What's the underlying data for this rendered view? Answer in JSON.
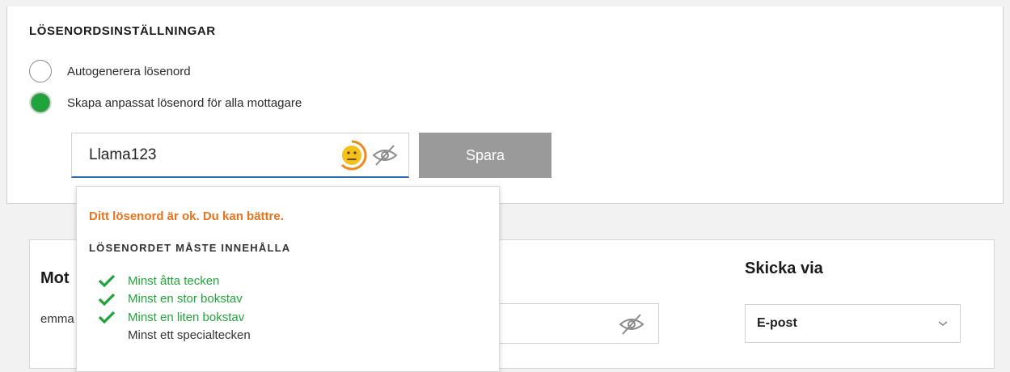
{
  "password_settings": {
    "title": "LÖSENORDSINSTÄLLNINGAR",
    "options": [
      {
        "label": "Autogenerera lösenord",
        "selected": false
      },
      {
        "label": "Skapa anpassat lösenord för alla mottagare",
        "selected": true
      }
    ],
    "password_value": "Llama123",
    "strength_icon": "neutral-face-icon",
    "visibility_icon": "eye-slash-icon",
    "save_label": "Spara",
    "colors": {
      "radio_selected": "#1fa43a",
      "strength_ring": "#f0891c",
      "strength_face": "#f3c01c",
      "save_button_bg": "#9a9a9a"
    }
  },
  "strength_popup": {
    "status": "Ditt lösenord är ok. Du kan bättre.",
    "subtitle": "LÖSENORDET MÅSTE INNEHÅLLA",
    "requirements": [
      {
        "label": "Minst åtta tecken",
        "met": true
      },
      {
        "label": "Minst en stor bokstav",
        "met": true
      },
      {
        "label": "Minst en liten bokstav",
        "met": true
      },
      {
        "label": "Minst ett specialtecken",
        "met": false
      }
    ],
    "colors": {
      "status": "#e8731a",
      "met": "#1fa43a"
    }
  },
  "recipients": {
    "header_partial": "Mot",
    "email_partial": "emma",
    "send_via_header": "Skicka via",
    "send_via_value": "E-post"
  }
}
